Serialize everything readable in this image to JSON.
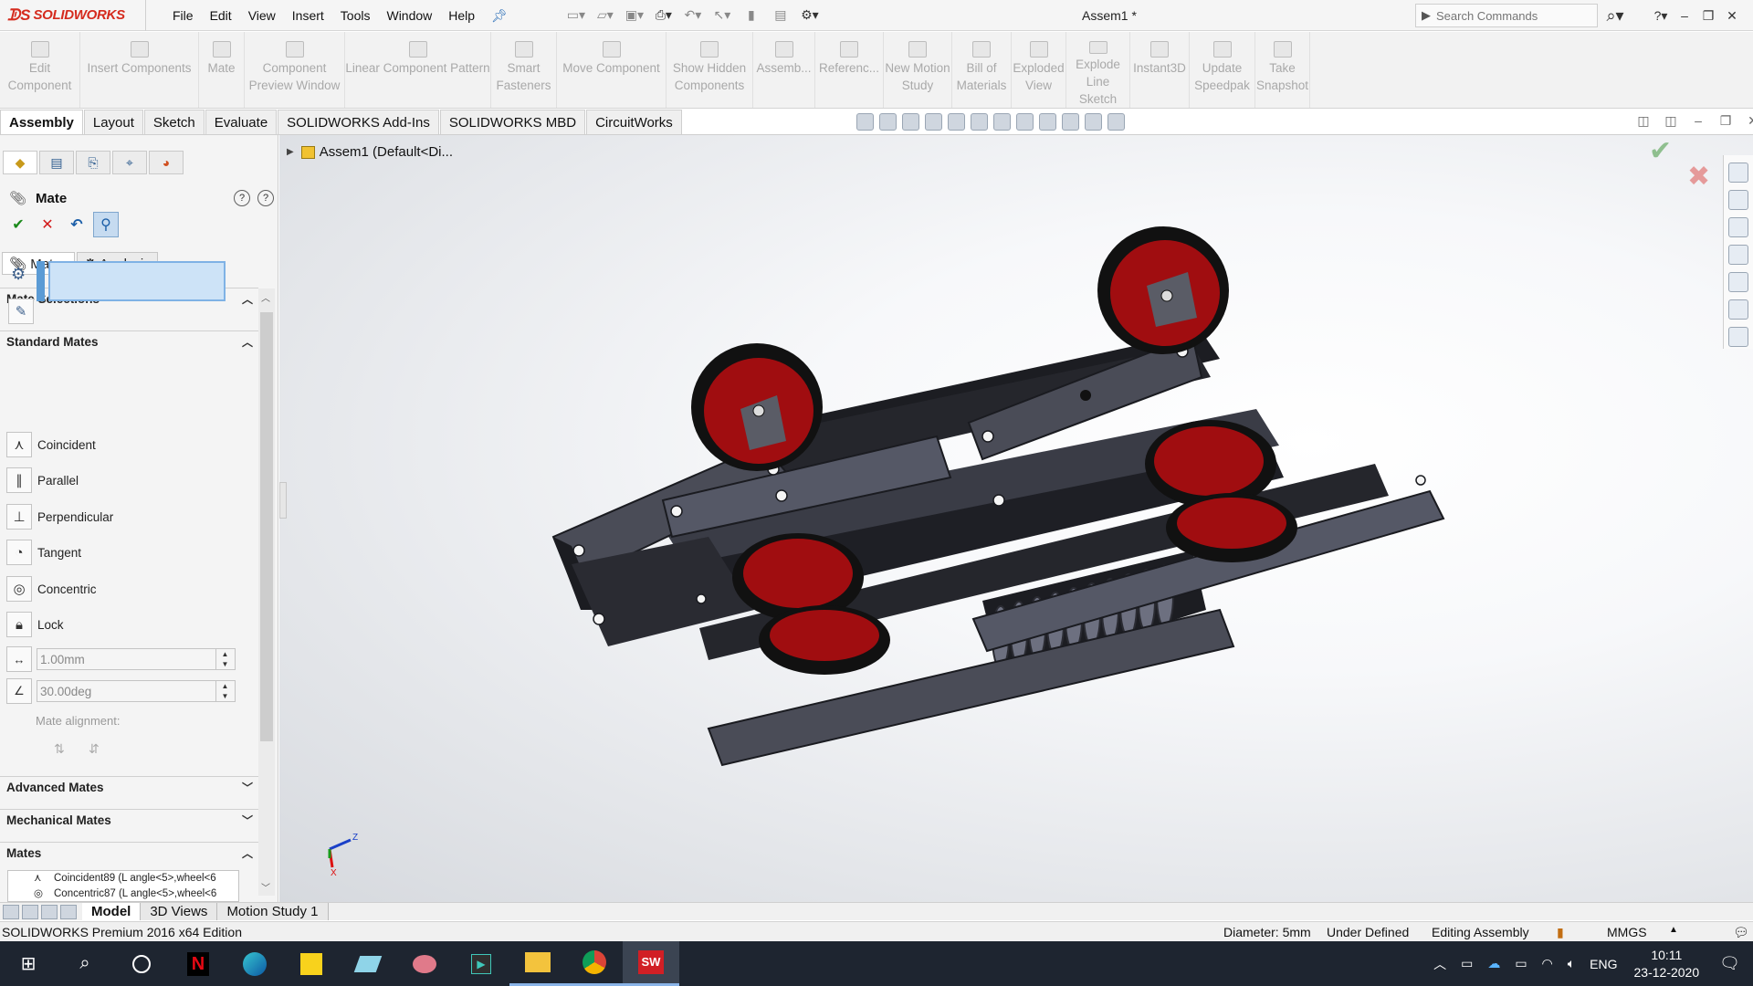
{
  "app": {
    "logo_text": "SOLIDWORKS",
    "document_title": "Assem1 *",
    "menu": [
      "File",
      "Edit",
      "View",
      "Insert",
      "Tools",
      "Window",
      "Help"
    ],
    "search_placeholder": "Search Commands"
  },
  "command_manager": [
    {
      "label": "Edit\nComponent"
    },
    {
      "label": "Insert Components"
    },
    {
      "label": "Mate"
    },
    {
      "label": "Component\nPreview Window"
    },
    {
      "label": "Linear Component Pattern"
    },
    {
      "label": "Smart\nFasteners"
    },
    {
      "label": "Move Component"
    },
    {
      "label": "Show Hidden\nComponents"
    },
    {
      "label": "Assemb..."
    },
    {
      "label": "Referenc..."
    },
    {
      "label": "New Motion\nStudy"
    },
    {
      "label": "Bill of\nMaterials"
    },
    {
      "label": "Exploded\nView"
    },
    {
      "label": "Explode\nLine Sketch"
    },
    {
      "label": "Instant3D"
    },
    {
      "label": "Update\nSpeedpak"
    },
    {
      "label": "Take\nSnapshot"
    }
  ],
  "tabs": [
    "Assembly",
    "Layout",
    "Sketch",
    "Evaluate",
    "SOLIDWORKS Add-Ins",
    "SOLIDWORKS MBD",
    "CircuitWorks"
  ],
  "active_tab": "Assembly",
  "property_manager": {
    "title": "Mate",
    "sub_tabs": [
      "Mates",
      "Analysis"
    ],
    "sections": {
      "mate_selections": "Mate Selections",
      "standard_mates": "Standard Mates",
      "advanced_mates": "Advanced Mates",
      "mechanical_mates": "Mechanical Mates",
      "mates": "Mates"
    },
    "standard_mates": [
      "Coincident",
      "Parallel",
      "Perpendicular",
      "Tangent",
      "Concentric",
      "Lock"
    ],
    "distance_value": "1.00mm",
    "angle_value": "30.00deg",
    "mate_alignment_label": "Mate alignment:",
    "mates_list": [
      "Coincident89 (L angle<5>,wheel<6",
      "Concentric87 (L angle<5>,wheel<6"
    ]
  },
  "feature_tree": {
    "root": "Assem1  (Default<Di..."
  },
  "triad": {
    "z": "Z",
    "x": "X"
  },
  "bottom_tabs": [
    "Model",
    "3D Views",
    "Motion Study 1"
  ],
  "active_bottom_tab": "Model",
  "status": {
    "edition": "SOLIDWORKS Premium 2016 x64 Edition",
    "diameter": "Diameter: 5mm",
    "constraint": "Under Defined",
    "mode": "Editing Assembly",
    "units": "MMGS"
  },
  "taskbar": {
    "language": "ENG",
    "time": "10:11",
    "date": "23-12-2020",
    "sw_badge": "SW"
  },
  "colors": {
    "wheel_red": "#a00d10",
    "frame": "#4a4c57",
    "dark": "#18191e",
    "taskbar": "#1e2530"
  }
}
